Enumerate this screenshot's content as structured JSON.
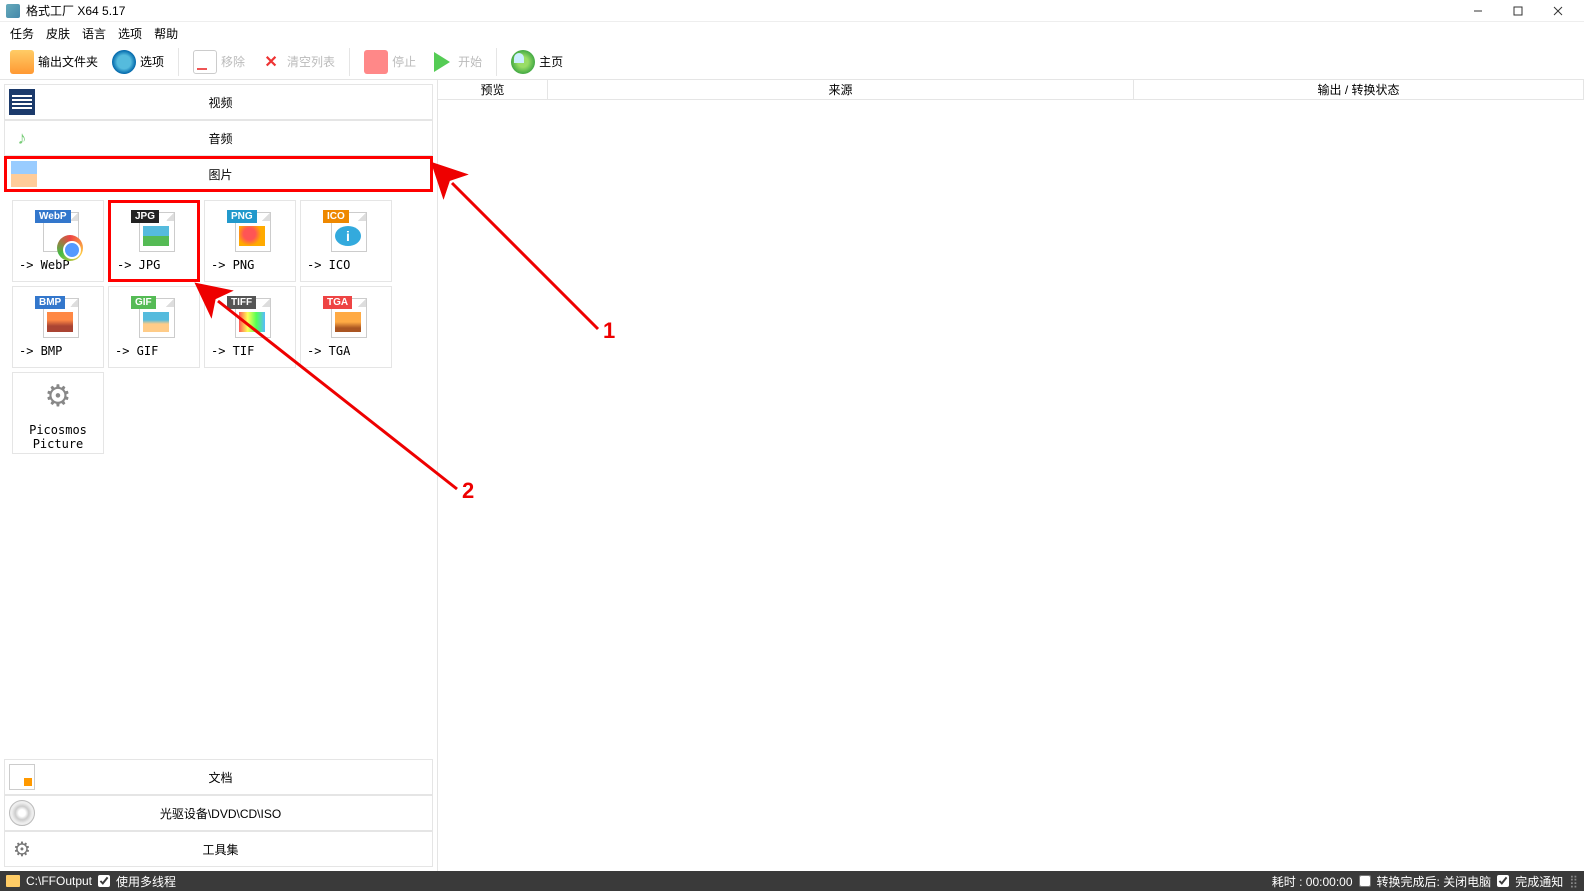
{
  "titlebar": {
    "title": "格式工厂 X64 5.17"
  },
  "menu": {
    "items": [
      "任务",
      "皮肤",
      "语言",
      "选项",
      "帮助"
    ]
  },
  "toolbar": {
    "output_folder": "输出文件夹",
    "options": "选项",
    "remove": "移除",
    "clear": "清空列表",
    "stop": "停止",
    "start": "开始",
    "home": "主页"
  },
  "categories": {
    "video": "视频",
    "audio": "音频",
    "image": "图片",
    "document": "文档",
    "disc": "光驱设备\\DVD\\CD\\ISO",
    "toolset": "工具集"
  },
  "formats": {
    "webp": "-> WebP",
    "jpg": "-> JPG",
    "png": "-> PNG",
    "ico": "-> ICO",
    "bmp": "-> BMP",
    "gif": "-> GIF",
    "tif": "-> TIF",
    "tga": "-> TGA",
    "picosmos": "Picosmos\nPicture",
    "badges": {
      "webp": "WebP",
      "jpg": "JPG",
      "png": "PNG",
      "ico": "ICO",
      "bmp": "BMP",
      "gif": "GIF",
      "tiff": "TIFF",
      "tga": "TGA"
    }
  },
  "table": {
    "preview": "预览",
    "source": "来源",
    "status": "输出 / 转换状态"
  },
  "status": {
    "path": "C:\\FFOutput",
    "multithread": "使用多线程",
    "elapsed": "耗时 : 00:00:00",
    "after": "转换完成后: 关闭电脑",
    "notify": "完成通知"
  },
  "annotations": {
    "one": "1",
    "two": "2"
  }
}
